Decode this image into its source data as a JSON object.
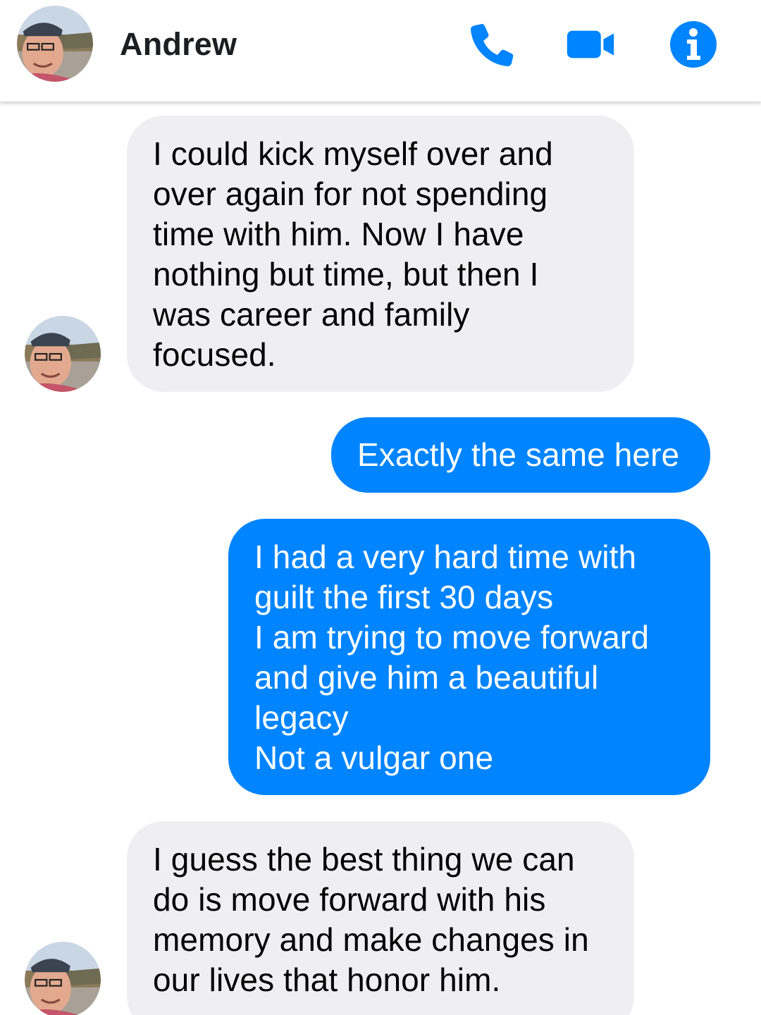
{
  "header": {
    "contact_name": "Andrew",
    "icons": [
      "avatar",
      "phone-icon",
      "video-camera-icon",
      "info-icon"
    ],
    "accent_color": "#0084ff"
  },
  "conversation": {
    "messages": [
      {
        "direction": "incoming",
        "text": "I could kick myself over and\nover again for not spending\ntime with him. Now I have\nnothing but time, but then I\nwas career and family\nfocused."
      },
      {
        "direction": "outgoing",
        "text": "Exactly the same here"
      },
      {
        "direction": "outgoing",
        "text": "I had a very hard time with\nguilt the first 30 days\nI am trying to move forward\nand give him a beautiful\nlegacy\nNot a vulgar one"
      },
      {
        "direction": "incoming",
        "text": "I guess the best thing we can\ndo is move forward with his\nmemory and make changes in\nour lives that honor him."
      }
    ],
    "incoming_bubble_color": "#efeff1",
    "outgoing_bubble_color": "#0084ff"
  }
}
